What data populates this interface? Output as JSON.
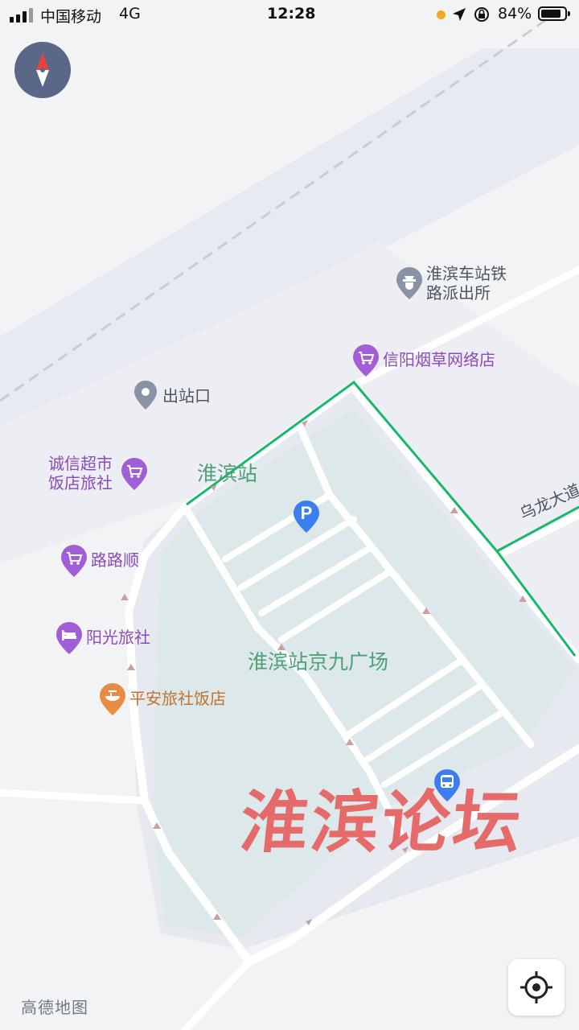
{
  "status_bar": {
    "carrier": "中国移动",
    "network": "4G",
    "time": "12:28",
    "battery": "84%",
    "battery_level": 0.84
  },
  "map": {
    "station_label": "淮滨站",
    "plaza_label": "淮滨站京九广场",
    "road_label": "乌龙大道",
    "watermark": "淮滨论坛",
    "attribution": "高德地图",
    "colors": {
      "background": "#f2f3f5",
      "rail_area": "#e6e9f1",
      "plaza": "#dde9ea",
      "road": "#ffffff",
      "route": "#18b86a",
      "poi_purple": "#a15ed6",
      "poi_gray": "#8a93a3",
      "poi_orange": "#e88b44",
      "parking": "#3b7ef0",
      "watermark": "#e56b6b"
    },
    "pois": [
      {
        "name_lines": [
          "淮滨车站铁",
          "路派出所"
        ],
        "icon": "police-icon",
        "category": "gray"
      },
      {
        "name_lines": [
          "信阳烟草网络店"
        ],
        "icon": "shopping-cart-icon",
        "category": "purple"
      },
      {
        "name_lines": [
          "出站口"
        ],
        "icon": "location-pin-icon",
        "category": "gray"
      },
      {
        "name_lines": [
          "诚信超市",
          "饭店旅社"
        ],
        "icon": "shopping-cart-icon",
        "category": "purple"
      },
      {
        "name_lines": [
          "路路顺"
        ],
        "icon": "shopping-cart-icon",
        "category": "purple"
      },
      {
        "name_lines": [
          "阳光旅社"
        ],
        "icon": "bed-icon",
        "category": "purple"
      },
      {
        "name_lines": [
          "平安旅社饭店"
        ],
        "icon": "restaurant-icon",
        "category": "orange"
      }
    ],
    "markers": [
      {
        "name": "parking",
        "glyph": "P",
        "icon": "parking-icon"
      },
      {
        "name": "bus-stop",
        "icon": "bus-icon"
      }
    ],
    "controls": {
      "compass": "compass-icon",
      "locate": "locate-icon"
    }
  }
}
